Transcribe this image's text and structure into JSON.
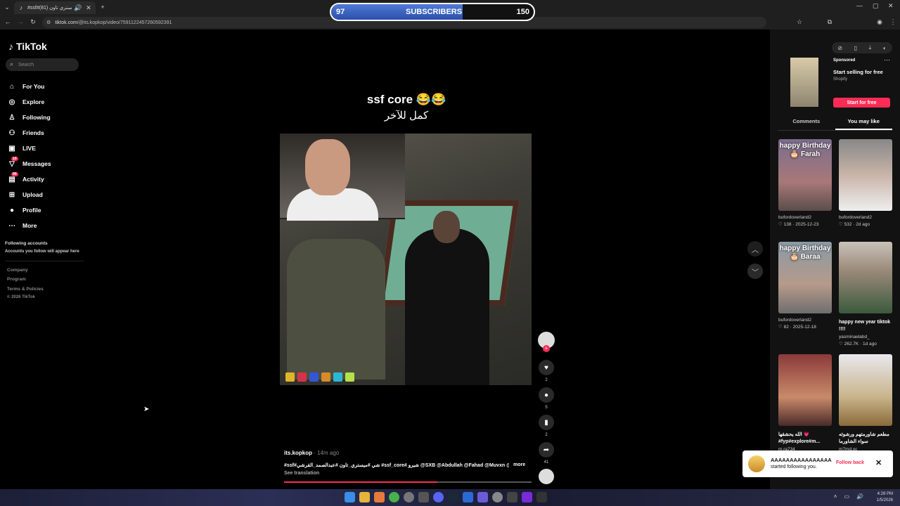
{
  "browser": {
    "tab_title": "#ssf#شي #ميستري تاون (81)",
    "url_domain": "tiktok.com",
    "url_path": "/@its.kopkop/video/7591122457260592391"
  },
  "overlay": {
    "subscribers_current": "97",
    "subscribers_label": "SUBSCRIBERS",
    "subscribers_goal": "150",
    "progress_fraction": 0.65
  },
  "sidebar": {
    "logo": "TikTok",
    "search_placeholder": "Search",
    "items": [
      {
        "icon": "home-icon",
        "glyph": "⌂",
        "label": "For You"
      },
      {
        "icon": "compass-icon",
        "glyph": "◎",
        "label": "Explore"
      },
      {
        "icon": "following-icon",
        "glyph": "♙",
        "label": "Following"
      },
      {
        "icon": "friends-icon",
        "glyph": "⚇",
        "label": "Friends"
      },
      {
        "icon": "live-icon",
        "glyph": "▣",
        "label": "LIVE"
      },
      {
        "icon": "messages-icon",
        "glyph": "▽",
        "label": "Messages",
        "badge": "10"
      },
      {
        "icon": "activity-icon",
        "glyph": "▤",
        "label": "Activity",
        "badge": "99"
      },
      {
        "icon": "upload-icon",
        "glyph": "⊞",
        "label": "Upload"
      },
      {
        "icon": "profile-icon",
        "glyph": "●",
        "label": "Profile"
      },
      {
        "icon": "more-icon",
        "glyph": "⋯",
        "label": "More"
      }
    ],
    "following_header": "Following accounts",
    "following_sub": "Accounts you follow will appear here",
    "footer": [
      "Company",
      "Program",
      "Terms & Policies",
      "© 2026 TikTok"
    ]
  },
  "video": {
    "caption_line1": "ssf core 😂😂",
    "caption_line2": "كمل للآخر",
    "author": "its.kopkop",
    "time": "· 14m ago",
    "description": "#ssf#شي #ميستري_تاون #عبدالصمد_القرشي #ssf_core# شيرو @SXB @Abdullah @Fahad @Muvxn @Rp...",
    "more": "more",
    "see_translation": "See translation",
    "progress_fraction": 0.62,
    "likes": "2",
    "comments": "5",
    "saves": "2",
    "shares": "41"
  },
  "right": {
    "ad_sponsored": "Sponsored",
    "ad_title": "Start selling for free",
    "ad_brand": "Shopify",
    "ad_button": "Start for free",
    "tab_comments": "Comments",
    "tab_you_may_like": "You may like",
    "cards": [
      {
        "thumb_text": "happy Birthday 🎂 Farah",
        "title": "",
        "user": "bufordoverland2",
        "likes": "♡ 138",
        "date": "2025-12-23"
      },
      {
        "thumb_text": "",
        "title": "",
        "user": "bufordoverland2",
        "likes": "♡ 532",
        "date": "2d ago"
      },
      {
        "thumb_text": "happy Birthday 🎂 Baraa",
        "title": "",
        "user": "bufordoverland2",
        "likes": "♡ 82",
        "date": "2025-12-18"
      },
      {
        "thumb_text": "",
        "title": "happy new year tiktok !!!!",
        "user": "yasminaelabd_",
        "likes": "♡ 262.7K",
        "date": "1d ago"
      },
      {
        "thumb_text": "",
        "title": "الله يحشقها 💗 #fyp#explore#m...",
        "user": "m.ra734",
        "likes": "",
        "date": ""
      },
      {
        "thumb_text": "",
        "title": "مطعم شاورمتهم ورشوئه سواء الشاورما",
        "user": "m7md.xc",
        "likes": "",
        "date": ""
      }
    ]
  },
  "toast": {
    "name": "AAAAAAAAAAAAAAAA",
    "status": "started following you.",
    "action": "Follow back"
  },
  "taskbar": {
    "time": "4:28 PM",
    "date": "1/5/2026"
  },
  "colors": {
    "accent": "#fe2c55",
    "bg": "#000000",
    "panel": "#121212"
  }
}
